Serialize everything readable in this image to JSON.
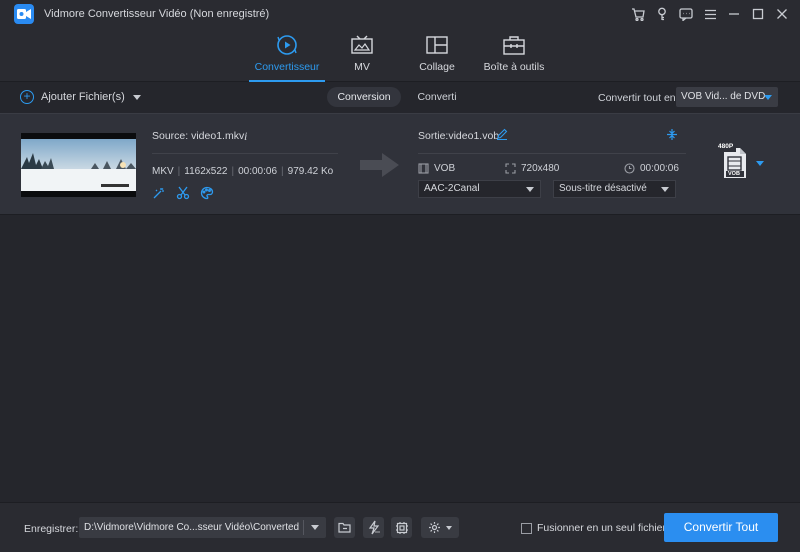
{
  "window": {
    "title": "Vidmore Convertisseur Vidéo (Non enregistré)"
  },
  "nav": {
    "tabs": [
      {
        "label": "Convertisseur",
        "active": true,
        "icon": "convert-icon"
      },
      {
        "label": "MV",
        "active": false,
        "icon": "mv-icon"
      },
      {
        "label": "Collage",
        "active": false,
        "icon": "collage-icon"
      },
      {
        "label": "Boîte à outils",
        "active": false,
        "icon": "toolbox-icon"
      }
    ]
  },
  "toolbar": {
    "add_files": "Ajouter Fichier(s)",
    "seg_conversion": "Conversion",
    "seg_converted": "Converti",
    "convert_all_label": "Convertir tout en:",
    "convert_all_value": "VOB Vid... de DVD"
  },
  "file": {
    "source": "Source: video1.mkv",
    "format": "MKV",
    "resolution": "1162x522",
    "duration": "00:00:06",
    "size": "979.42 Ko",
    "output": "Sortie:video1.vob",
    "out_format": "VOB",
    "out_resolution": "720x480",
    "out_duration": "00:00:06",
    "audio": "AAC-2Canal",
    "subtitle": "Sous-titre désactivé",
    "badge_quality": "480P",
    "badge_format": "VOB"
  },
  "bottom": {
    "save_label": "Enregistrer:",
    "save_path": "D:\\Vidmore\\Vidmore Co...sseur Vidéo\\Converted",
    "merge_label": "Fusionner en un seul fichier",
    "convert_button": "Convertir Tout"
  },
  "colors": {
    "accent": "#2d9bf0",
    "background": "#25262c",
    "panel": "#30323a"
  }
}
